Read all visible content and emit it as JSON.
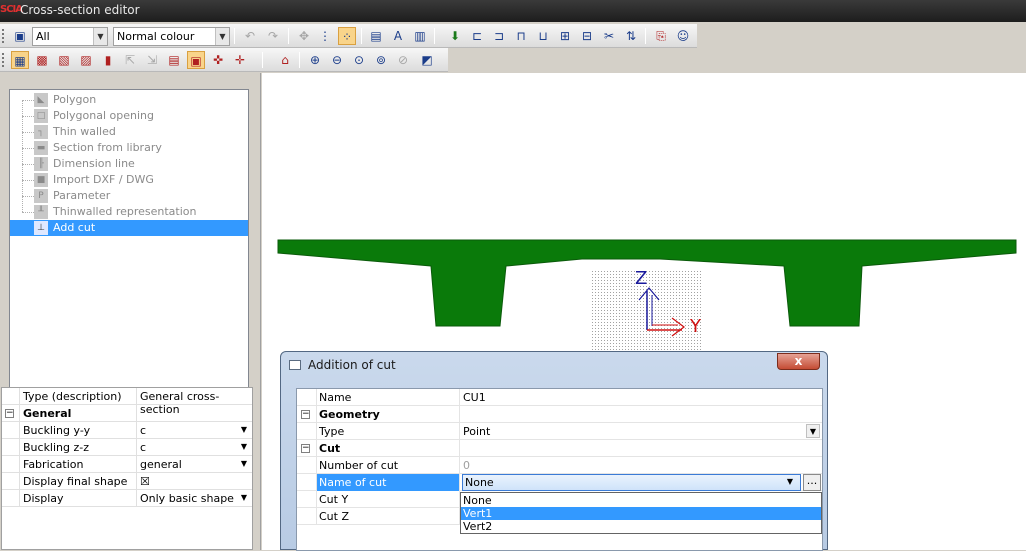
{
  "window": {
    "logo": "SCIA",
    "title": "Cross-section editor"
  },
  "toolbar": {
    "filter_value": "All",
    "colour_value": "Normal colour"
  },
  "tree": {
    "items": [
      {
        "label": "Polygon",
        "icon": "polygon-icon"
      },
      {
        "label": "Polygonal opening",
        "icon": "polygonal-opening-icon"
      },
      {
        "label": "Thin walled",
        "icon": "thin-walled-icon"
      },
      {
        "label": "Section from library",
        "icon": "library-icon"
      },
      {
        "label": "Dimension line",
        "icon": "dimension-line-icon"
      },
      {
        "label": "Import DXF / DWG",
        "icon": "import-icon"
      },
      {
        "label": "Parameter",
        "icon": "parameter-icon"
      },
      {
        "label": "Thinwalled representation",
        "icon": "thinwalled-representation-icon"
      },
      {
        "label": "Add cut",
        "icon": "add-cut-icon",
        "selected": true
      }
    ]
  },
  "properties": {
    "rows": [
      {
        "label": "Type (description)",
        "value": "General cross-section"
      },
      {
        "label": "General",
        "value": "",
        "group": true
      },
      {
        "label": "Buckling y-y",
        "value": "c",
        "dropdown": true
      },
      {
        "label": "Buckling z-z",
        "value": "c",
        "dropdown": true
      },
      {
        "label": "Fabrication",
        "value": "general",
        "dropdown": true
      },
      {
        "label": "Display final shape",
        "value": "☒"
      },
      {
        "label": "Display",
        "value": "Only basic shape",
        "dropdown": true
      }
    ]
  },
  "canvas": {
    "axis_z": "Z",
    "axis_y": "Y",
    "colors": {
      "section": "#0a7a0a",
      "axis_z": "#1a1a9c",
      "axis_y": "#d01010"
    }
  },
  "dialog": {
    "title": "Addition of cut",
    "close_label": "x",
    "rows": [
      {
        "label": "Name",
        "value": "CU1"
      },
      {
        "label": "Geometry",
        "value": "",
        "group": true
      },
      {
        "label": "Type",
        "value": "Point",
        "dropdown": true
      },
      {
        "label": "Cut",
        "value": "",
        "group": true
      },
      {
        "label": "Number of cut",
        "value": "0",
        "disabled": true
      },
      {
        "label": "Name of cut",
        "value": "None",
        "highlight": true,
        "dropdown": true
      },
      {
        "label": "Cut Y",
        "value": ""
      },
      {
        "label": "Cut Z",
        "value": ""
      }
    ],
    "more_button": "...",
    "dropdown_options": [
      "None",
      "Vert1",
      "Vert2"
    ],
    "dropdown_selected": "Vert1"
  }
}
